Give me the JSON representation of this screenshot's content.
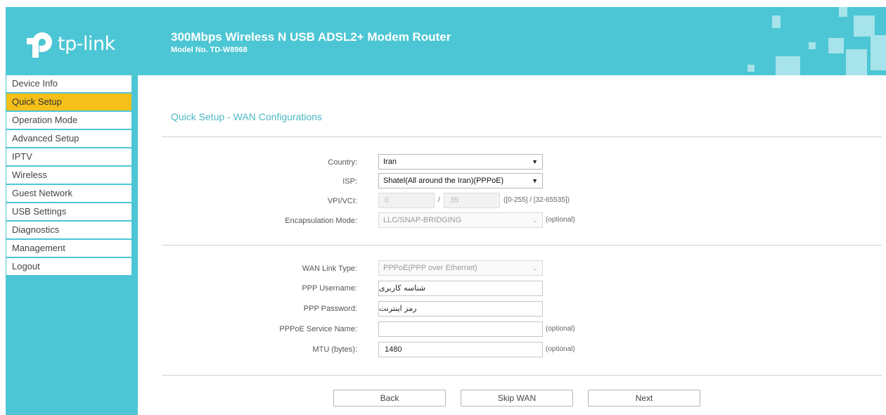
{
  "header": {
    "logo_text": "tp-link",
    "title": "300Mbps Wireless N USB ADSL2+ Modem Router",
    "model": "Model No. TD-W8968"
  },
  "sidebar": {
    "items": [
      {
        "label": "Device Info"
      },
      {
        "label": "Quick Setup",
        "active": true
      },
      {
        "label": "Operation Mode"
      },
      {
        "label": "Advanced Setup"
      },
      {
        "label": "IPTV"
      },
      {
        "label": "Wireless"
      },
      {
        "label": "Guest Network"
      },
      {
        "label": "USB Settings"
      },
      {
        "label": "Diagnostics"
      },
      {
        "label": "Management"
      },
      {
        "label": "Logout"
      }
    ]
  },
  "main": {
    "title": "Quick Setup - WAN Configurations",
    "country": {
      "label": "Country:",
      "value": "Iran"
    },
    "isp": {
      "label": "ISP:",
      "value": "Shatel(All around the Iran)(PPPoE)"
    },
    "vpivci": {
      "label": "VPI/VCI:",
      "vpi": "0",
      "separator": "/",
      "vci": "35",
      "range": "([0-255] / [32-65535])"
    },
    "encapsulation": {
      "label": "Encapsulation Mode:",
      "value": "LLC/SNAP-BRIDGING",
      "note": "(optional)"
    },
    "wan_link_type": {
      "label": "WAN Link Type:",
      "value": "PPPoE(PPP over Ethernet)"
    },
    "ppp_username": {
      "label": "PPP Username:",
      "value": "شناسه کاربری"
    },
    "ppp_password": {
      "label": "PPP Password:",
      "value": "رمز اینترنت"
    },
    "pppoe_service": {
      "label": "PPPoE Service Name:",
      "value": "",
      "note": "(optional)"
    },
    "mtu": {
      "label": "MTU (bytes):",
      "value": "1480",
      "note": "(optional)"
    }
  },
  "buttons": {
    "back": "Back",
    "skip_wan": "Skip WAN",
    "next": "Next"
  },
  "colors": {
    "brand": "#4cc6d4",
    "active": "#f6c01a",
    "title": "#4cb8c5"
  }
}
